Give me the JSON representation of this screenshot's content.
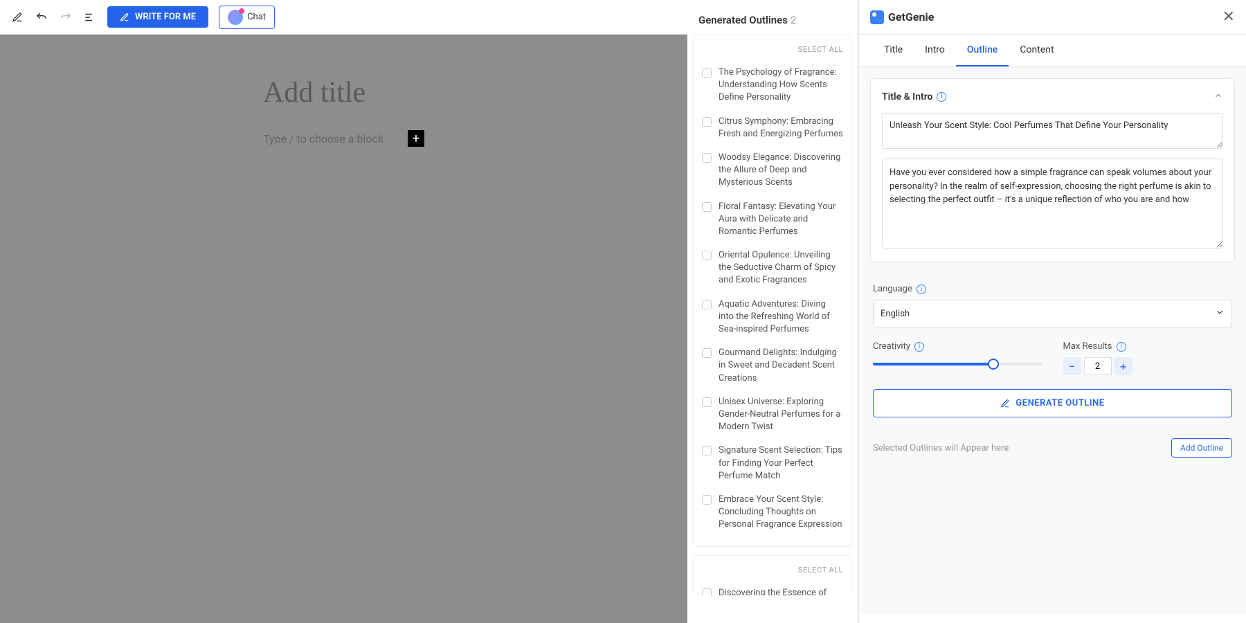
{
  "topbar": {
    "writeForMe": "WRITE FOR ME",
    "chat": "Chat"
  },
  "editor": {
    "titlePlaceholder": "Add title",
    "blockPlaceholder": "Type / to choose a block"
  },
  "outlines": {
    "header": "Generated Outlines",
    "count": "2",
    "selectAll": "SELECT ALL",
    "items": [
      "The Psychology of Fragrance: Understanding How Scents Define Personality",
      "Citrus Symphony: Embracing Fresh and Energizing Perfumes",
      "Woodsy Elegance: Discovering the Allure of Deep and Mysterious Scents",
      "Floral Fantasy: Elevating Your Aura with Delicate and Romantic Perfumes",
      "Oriental Opulence: Unveiling the Seductive Charm of Spicy and Exotic Fragrances",
      "Aquatic Adventures: Diving into the Refreshing World of Sea-inspired Perfumes",
      "Gourmand Delights: Indulging in Sweet and Decadent Scent Creations",
      "Unisex Universe: Exploring Gender-Neutral Perfumes for a Modern Twist",
      "Signature Scent Selection: Tips for Finding Your Perfect Perfume Match",
      "Embrace Your Scent Style: Concluding Thoughts on Personal Fragrance Expression"
    ],
    "items2": [
      "Discovering the Essence of"
    ]
  },
  "sidebar": {
    "brand": "GetGenie",
    "tabs": {
      "title": "Title",
      "intro": "Intro",
      "outline": "Outline",
      "content": "Content"
    },
    "titleIntro": {
      "header": "Title & Intro",
      "title": "Unleash Your Scent Style: Cool Perfumes That Define Your Personality",
      "intro": "Have you ever considered how a simple fragrance can speak volumes about your personality? In the realm of self-expression, choosing the right perfume is akin to selecting the perfect outfit – it's a unique reflection of who you are and how"
    },
    "language": {
      "label": "Language",
      "value": "English"
    },
    "creativity": {
      "label": "Creativity"
    },
    "maxResults": {
      "label": "Max Results",
      "value": "2"
    },
    "generateBtn": "GENERATE OUTLINE",
    "selectedPlaceholder": "Selected Outlines will Appear here",
    "addOutline": "Add Outline"
  }
}
